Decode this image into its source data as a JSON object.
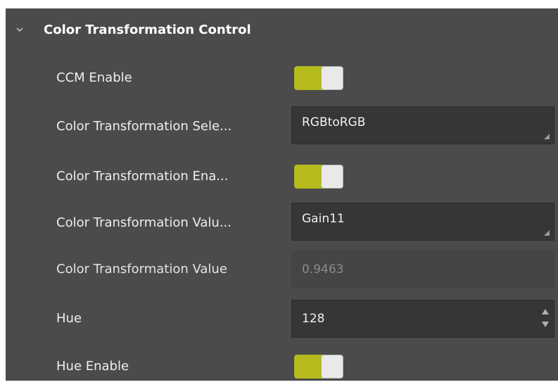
{
  "group": {
    "title": "Color Transformation Control",
    "expanded": true
  },
  "rows": [
    {
      "label": "CCM Enable",
      "control": "toggle",
      "value": true
    },
    {
      "label": "Color Transformation Sele...",
      "control": "select",
      "value": "RGBtoRGB"
    },
    {
      "label": "Color Transformation Ena...",
      "control": "toggle",
      "value": true
    },
    {
      "label": "Color Transformation Valu...",
      "control": "select",
      "value": "Gain11"
    },
    {
      "label": "Color Transformation Value",
      "control": "readonly",
      "value": "0.9463"
    },
    {
      "label": "Hue",
      "control": "spinbox",
      "value": "128"
    },
    {
      "label": "Hue Enable",
      "control": "toggle",
      "value": true
    }
  ],
  "colors": {
    "panel_bg": "#4b4b4b",
    "toggle_on": "#b5bb1c",
    "field_bg": "#363636"
  },
  "icons": {
    "expand": "chevron-down-icon",
    "dropdown": "dropdown-corner-icon",
    "spin": "spin-arrows-icon"
  }
}
